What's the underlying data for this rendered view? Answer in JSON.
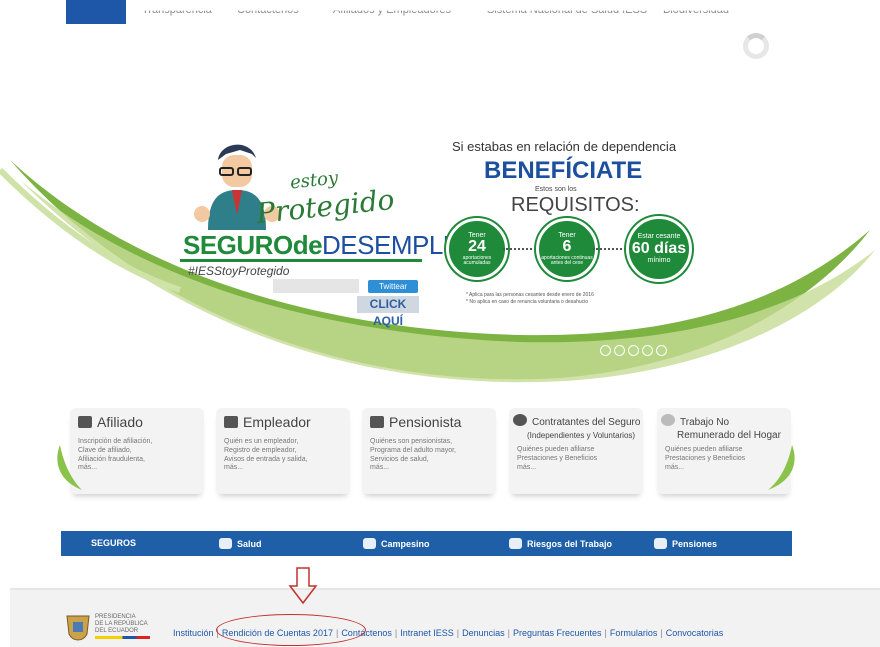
{
  "nav": {
    "items": [
      "Transparencia",
      "Contáctenos",
      "Afiliados y Empleadores",
      "Sistema Nacional de Salud IESS",
      "Biodiversidad"
    ]
  },
  "banner": {
    "estoy": "estoy",
    "protegido": "Protegido",
    "seguro_part1": "SEGURO",
    "seguro_part2": "de",
    "seguro_part3": "DESEMPLEO",
    "hashtag": "#IESStoyProtegido",
    "twitter": "Twittear",
    "clic": "CLICK AQUÍ",
    "intro": "Si estabas en relación de dependencia",
    "headline": "BENEFÍCIATE",
    "estos": "Estos son los",
    "requisitos": "REQUISITOS:",
    "req1": {
      "top": "Tener",
      "big": "24",
      "bottom": "aportaciones acumuladas"
    },
    "req2": {
      "top": "Tener",
      "big": "6",
      "bottom": "aportaciones continuas antes del cese"
    },
    "req3": {
      "top": "Estar cesante",
      "big": "60 días",
      "bottom": "mínimo"
    },
    "note1": "* Aplica para las personas cesantes desde enero de 2016",
    "note2": "* No aplica en caso de renuncia voluntaria o desahucio",
    "slides": 5
  },
  "cards": [
    {
      "title": "Afiliado",
      "desc": "Inscripción de afiliación,\nClave de afiliado,\nAfiliación fraudulenta,\nmás..."
    },
    {
      "title": "Empleador",
      "desc": "Quién es un empleador,\nRegistro de empleador,\nAvisos de entrada y salida,\nmás..."
    },
    {
      "title": "Pensionista",
      "desc": "Quiénes son pensionistas,\nPrograma del adulto mayor,\nServicios de salud,\nmás..."
    },
    {
      "title": "Contratantes del Seguro",
      "subtitle": "(Independientes y Voluntarios)",
      "desc": "Quiénes pueden afiliarse\nPrestaciones y Beneficios\nmás..."
    },
    {
      "title": "Trabajo No",
      "subtitle": "Remunerado del Hogar",
      "desc": "Quiénes pueden afiliarse\nPrestaciones y Beneficios\nmás..."
    }
  ],
  "seguros": {
    "label": "SEGUROS",
    "items": [
      "Salud",
      "Campesino",
      "Riesgos del Trabajo",
      "Pensiones"
    ]
  },
  "footer": {
    "presidencia": "PRESIDENCIA\nDE LA REPÚBLICA\nDEL ECUADOR",
    "links": [
      "Institución",
      "Rendición de Cuentas 2017",
      "Contáctenos",
      "Intranet IESS",
      "Denuncias",
      "Preguntas Frecuentes",
      "Formularios",
      "Convocatorias"
    ]
  },
  "colors": {
    "brand_blue": "#1e5fa8",
    "brand_green": "#1f8a3a",
    "annotation_red": "#c0302c"
  }
}
